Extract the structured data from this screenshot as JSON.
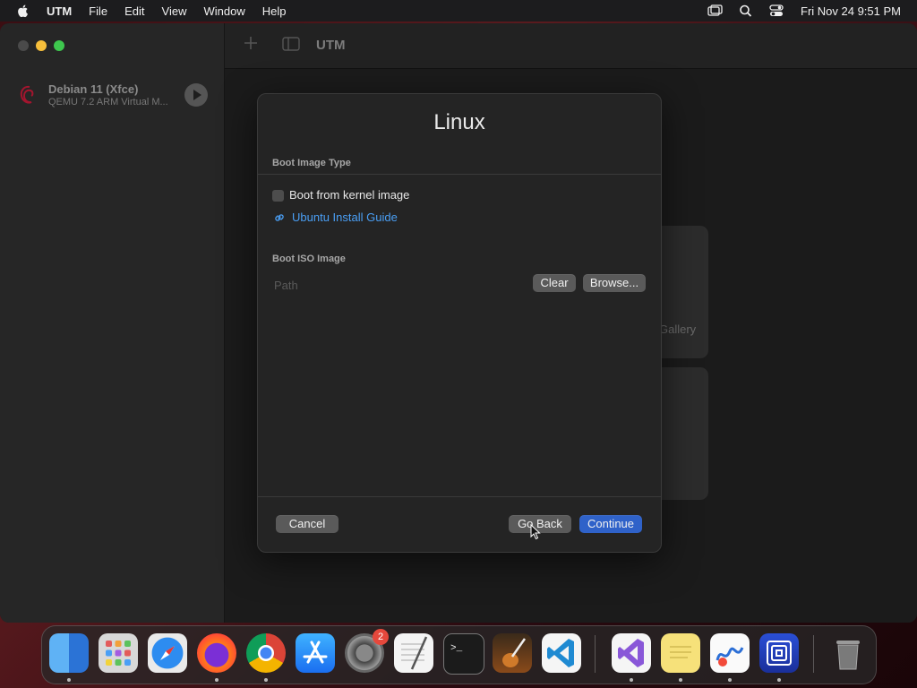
{
  "menubar": {
    "apple": "apple-icon",
    "app": "UTM",
    "items": [
      "File",
      "Edit",
      "View",
      "Window",
      "Help"
    ],
    "clock": "Fri Nov 24  9:51 PM",
    "status_icons": [
      "screen-mirroring-icon",
      "spotlight-icon",
      "control-center-icon"
    ]
  },
  "sidebar": {
    "vm": {
      "name": "Debian 11 (Xfce)",
      "subtitle": "QEMU 7.2 ARM Virtual M..."
    }
  },
  "toolbar": {
    "title": "UTM"
  },
  "background": {
    "gallery_text": "Gallery"
  },
  "dialog": {
    "title": "Linux",
    "boot_image_type_label": "Boot Image Type",
    "kernel_checkbox_label": "Boot from kernel image",
    "kernel_checkbox_checked": false,
    "guide_link": "Ubuntu Install Guide",
    "boot_iso_label": "Boot ISO Image",
    "path_placeholder": "Path",
    "clear_button": "Clear",
    "browse_button": "Browse...",
    "cancel_button": "Cancel",
    "go_back_button": "Go Back",
    "continue_button": "Continue"
  },
  "dock": {
    "apps": [
      "Finder",
      "Launchpad",
      "Safari",
      "Firefox",
      "Chrome",
      "App Store",
      "System Settings",
      "TextEdit",
      "Terminal",
      "GarageBand",
      "VS Code",
      "Visual Studio",
      "Stickies",
      "Freeform",
      "UTM",
      "Trash"
    ],
    "system_settings_badge": "2"
  },
  "colors": {
    "accent": "#2f62c9",
    "link": "#4a9ff5"
  }
}
